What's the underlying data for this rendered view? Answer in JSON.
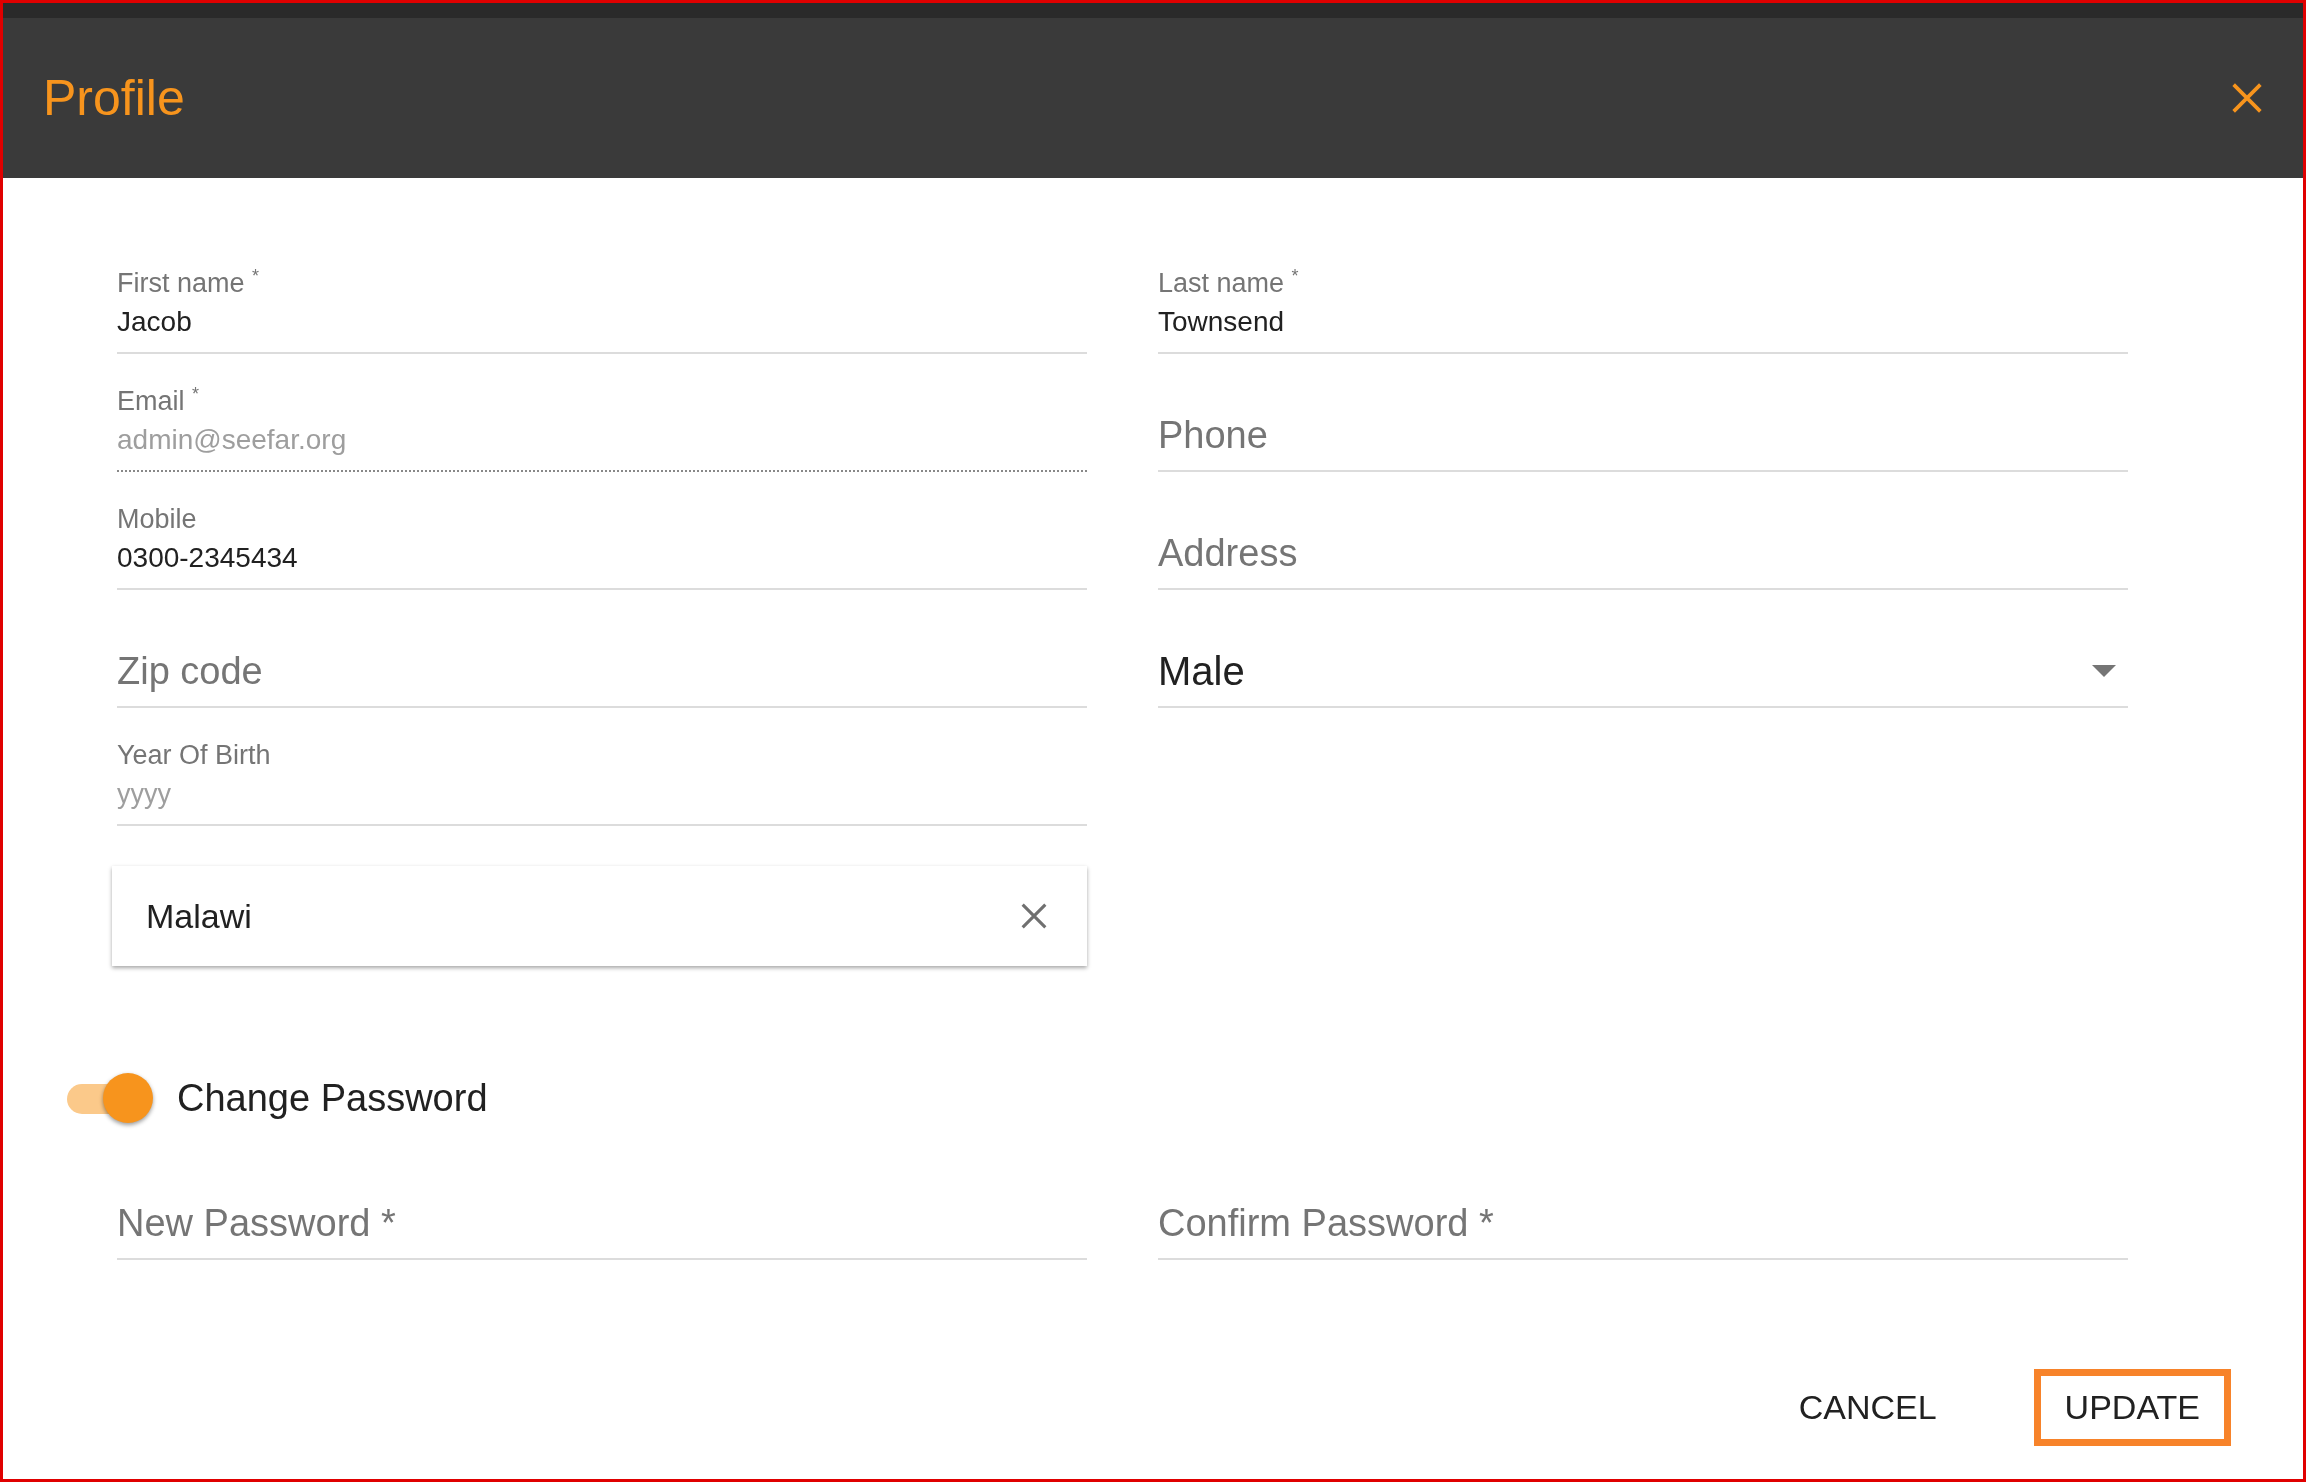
{
  "dialog": {
    "title": "Profile"
  },
  "left_fields": [
    {
      "kind": "text",
      "label": "First name $^{*}$",
      "value": "Jacob",
      "disabled": false
    },
    {
      "kind": "text",
      "label": "Email $^{*}$",
      "value": "admin@seefar.org",
      "disabled": true
    },
    {
      "kind": "text",
      "label": "Mobile",
      "value": "0300-2345434",
      "disabled": false
    },
    {
      "kind": "hint",
      "placeholder": "Zip code",
      "disabled": false
    },
    {
      "kind": "text",
      "label": "Year Of Birth",
      "placeholder": "yyyy",
      "disabled": false
    }
  ],
  "right_fields": [
    {
      "kind": "text",
      "label": "Last name $^{*}$",
      "value": "Townsend",
      "disabled": false
    },
    {
      "kind": "hint",
      "placeholder": "Phone",
      "disabled": false
    },
    {
      "kind": "hint",
      "placeholder": "Address",
      "disabled": false
    },
    {
      "kind": "select",
      "value": "Male",
      "disabled": false
    }
  ],
  "country": {
    "value": "Malawi"
  },
  "change_password": {
    "label": "Change Password",
    "on": true
  },
  "password_fields": [
    {
      "kind": "hint",
      "placeholder": "New Password *",
      "disabled": false
    },
    {
      "kind": "hint",
      "placeholder": "Confirm Password *",
      "disabled": false
    }
  ],
  "buttons": [
    {
      "label": "CANCEL",
      "selected": false
    },
    {
      "label": "UPDATE",
      "selected": true
    }
  ]
}
